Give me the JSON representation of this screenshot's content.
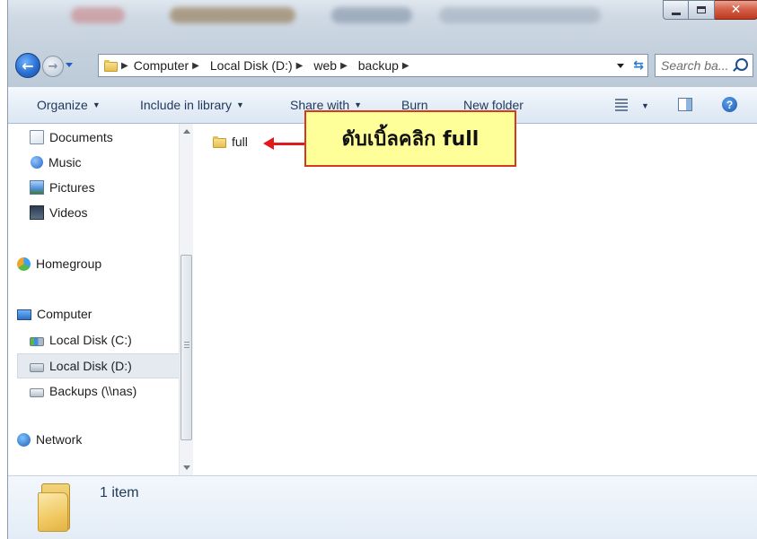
{
  "window": {
    "controls": {
      "minimize": "minimize-icon",
      "maximize": "maximize-icon",
      "close": "close-icon"
    }
  },
  "address_bar": {
    "breadcrumbs": [
      "Computer",
      "Local Disk (D:)",
      "web",
      "backup"
    ],
    "search_placeholder": "Search ba..."
  },
  "toolbar": {
    "organize": "Organize",
    "include_in_library": "Include in library",
    "share_with": "Share with",
    "burn": "Burn",
    "new_folder": "New folder"
  },
  "nav_pane": {
    "items": [
      {
        "label": "Documents",
        "icon": "documents-icon"
      },
      {
        "label": "Music",
        "icon": "music-icon"
      },
      {
        "label": "Pictures",
        "icon": "pictures-icon"
      },
      {
        "label": "Videos",
        "icon": "videos-icon"
      },
      {
        "label": "Homegroup",
        "icon": "homegroup-icon"
      },
      {
        "label": "Computer",
        "icon": "computer-icon"
      },
      {
        "label": "Local Disk (C:)",
        "icon": "drive-icon"
      },
      {
        "label": "Local Disk (D:)",
        "icon": "drive-icon",
        "selected": true
      },
      {
        "label": "Backups (\\\\nas)",
        "icon": "network-drive-icon"
      },
      {
        "label": "Network",
        "icon": "network-icon"
      }
    ]
  },
  "content": {
    "files": [
      {
        "name": "full",
        "icon": "folder-icon"
      }
    ],
    "annotation": "ดับเบิ้ลคลิก full"
  },
  "details_pane": {
    "item_count": "1 item"
  },
  "colors": {
    "annotation_fill": "#ffff99",
    "annotation_border": "#d43a1e",
    "arrow": "#e11b1b",
    "close_button": "#c0391f"
  }
}
